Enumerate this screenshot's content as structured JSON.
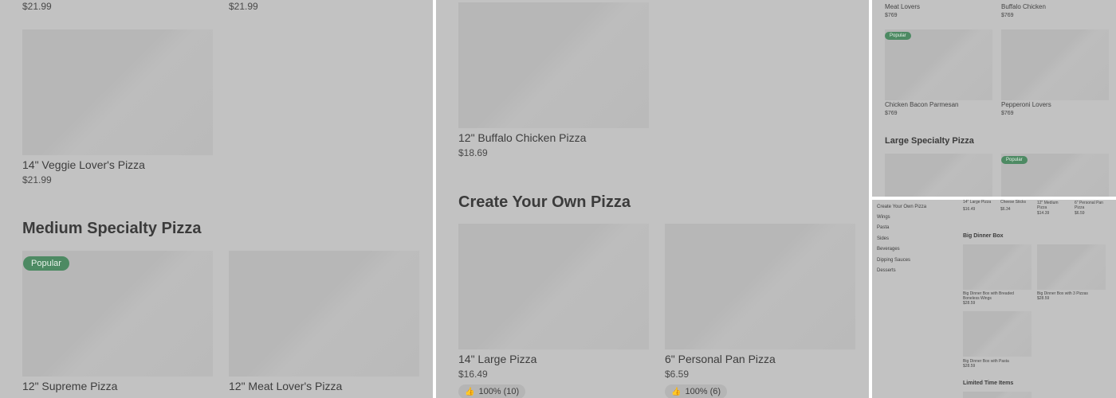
{
  "panel1": {
    "top_prices": [
      "$21.99",
      "$21.99"
    ],
    "item": {
      "title": "14\" Veggie Lover's Pizza",
      "price": "$21.99"
    },
    "section_heading": "Medium Specialty Pizza",
    "badge": "Popular",
    "bottom_items": [
      {
        "title": "12\" Supreme Pizza"
      },
      {
        "title": "12\" Meat Lover's Pizza"
      }
    ]
  },
  "panel2": {
    "item": {
      "title": "12\" Buffalo Chicken Pizza",
      "price": "$18.69"
    },
    "section_heading": "Create Your Own Pizza",
    "items": [
      {
        "title": "14\" Large Pizza",
        "price": "$16.49",
        "rating": "100% (10)"
      },
      {
        "title": "6\" Personal Pan Pizza",
        "price": "$6.59",
        "rating": "100% (6)"
      }
    ]
  },
  "panel3": {
    "top_items": [
      {
        "title": "Meat Lovers",
        "price": "$769"
      },
      {
        "title": "Buffalo Chicken",
        "price": "$769"
      }
    ],
    "badge": "Popular",
    "items": [
      {
        "title": "Chicken Bacon Parmesan",
        "price": "$769"
      },
      {
        "title": "Pepperoni Lovers",
        "price": "$769"
      }
    ],
    "section_heading": "Large Specialty Pizza",
    "badge2": "Popular"
  },
  "panel4": {
    "sidebar": [
      "Create Your Own Pizza",
      "Wings",
      "Pasta",
      "Sides",
      "Beverages",
      "Dipping Sauces",
      "Desserts"
    ],
    "top_items": [
      {
        "title": "14\" Large Pizza",
        "price": "$16.49"
      },
      {
        "title": "Cheese Sticks",
        "price": "$6.34"
      },
      {
        "title": "12\" Medium Pizza",
        "price": "$14.39"
      },
      {
        "title": "6\" Personal Pan Pizza",
        "price": "$6.59"
      }
    ],
    "section_heading": "Big Dinner Box",
    "items": [
      {
        "title": "Big Dinner Box with Breaded Boneless Wings",
        "price": "$28.59"
      },
      {
        "title": "Big Dinner Box with 3 Pizzas",
        "price": "$28.59"
      },
      {
        "title": "Big Dinner Box with Pasta",
        "price": "$28.59"
      }
    ],
    "section_heading2": "Limited Time Items"
  },
  "icons": {
    "like": "thumbs-up-icon"
  }
}
